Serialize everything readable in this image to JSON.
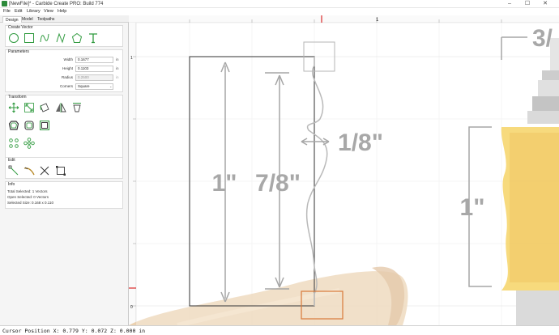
{
  "window": {
    "title": "[NewFile]* - Carbide Create PRO: Build 774",
    "minimize": "–",
    "maximize": "☐",
    "close": "✕"
  },
  "menu": [
    "File",
    "Edit",
    "Library",
    "View",
    "Help"
  ],
  "tabs": [
    "Design",
    "Model",
    "Toolpaths"
  ],
  "create_vector": {
    "title": "Create Vector",
    "tools": [
      "circle-icon",
      "rectangle-icon",
      "curve-icon",
      "polyline-icon",
      "polygon-icon",
      "text-icon"
    ]
  },
  "parameters": {
    "title": "Parameters",
    "width_label": "Width",
    "width_value": "0.1677",
    "height_label": "Height",
    "height_value": "0.1103",
    "radius_label": "Radius",
    "radius_value": "0.2500",
    "unit": "in",
    "corners_label": "Corners",
    "corners_value": "Square"
  },
  "transform": {
    "title": "Transform",
    "tools": [
      "move-icon",
      "scale-icon",
      "rotate-icon",
      "mirror-icon",
      "align-icon",
      "offset-icon",
      "smooth-icon",
      "boolean-icon",
      "array-icon",
      "circular-array-icon"
    ]
  },
  "edit": {
    "title": "Edit",
    "tools": [
      "node-edit-icon",
      "trim-icon",
      "cut-icon",
      "fit-icon"
    ]
  },
  "info": {
    "title": "Info",
    "total_selected": "Total Selected: 1 Vectors",
    "open_selected": "Open Selected: 0 Vectors",
    "selected_size": "Selected Size: 0.168 x 0.110"
  },
  "canvas": {
    "ruler_top_label": "1",
    "ruler_left_labels": [
      "1",
      "0"
    ],
    "dim_1in": "1\"",
    "dim_7_8": "7/8\"",
    "dim_1_8": "1/8\"",
    "dim_right_1in": "1\"",
    "dim_3_partial": "3/",
    "colors": {
      "accent_red": "#d40000",
      "selection_orange": "#d97a3a",
      "bit_yellow": "#f2c01e",
      "wood": "#e8c9a2"
    }
  },
  "status": {
    "text": "Cursor Position X: 0.779 Y: 0.072 Z: 0.000 in"
  }
}
